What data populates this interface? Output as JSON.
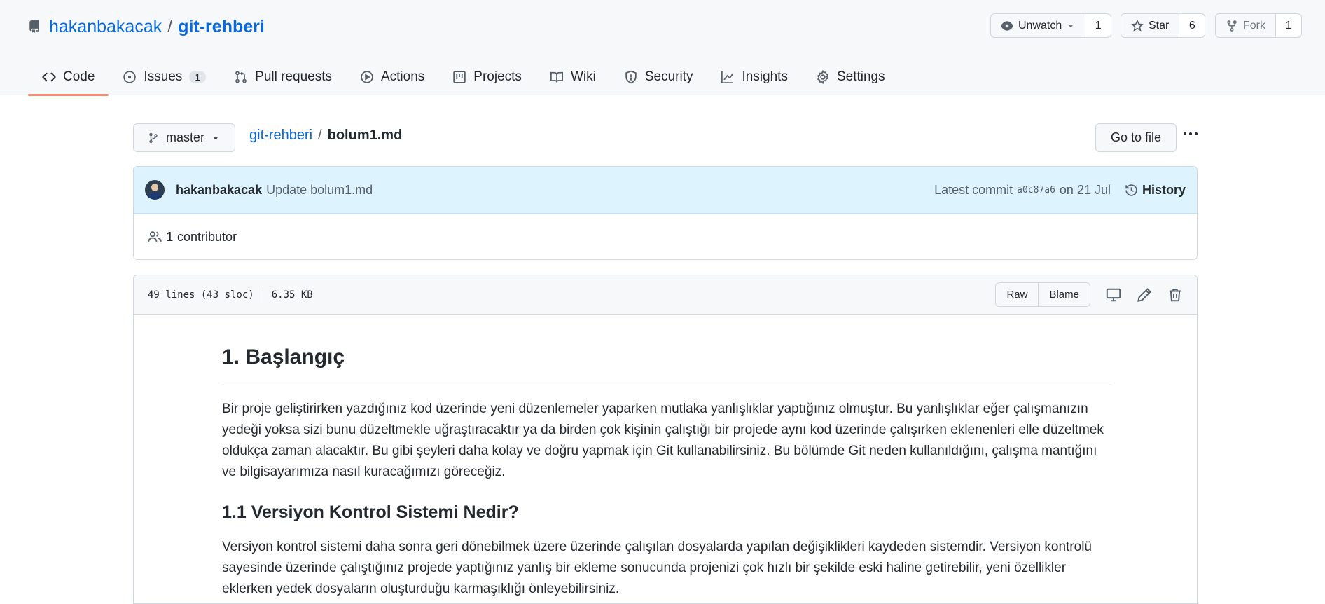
{
  "repo": {
    "owner": "hakanbakacak",
    "separator": "/",
    "name": "git-rehberi"
  },
  "repo_actions": {
    "watch_label": "Unwatch",
    "watch_count": "1",
    "star_label": "Star",
    "star_count": "6",
    "fork_label": "Fork",
    "fork_count": "1"
  },
  "tabs": [
    {
      "label": "Code",
      "icon": "code-icon",
      "active": true
    },
    {
      "label": "Issues",
      "icon": "issue-opened-icon",
      "counter": "1"
    },
    {
      "label": "Pull requests",
      "icon": "git-pull-request-icon"
    },
    {
      "label": "Actions",
      "icon": "play-icon"
    },
    {
      "label": "Projects",
      "icon": "project-icon"
    },
    {
      "label": "Wiki",
      "icon": "book-icon"
    },
    {
      "label": "Security",
      "icon": "shield-icon"
    },
    {
      "label": "Insights",
      "icon": "graph-icon"
    },
    {
      "label": "Settings",
      "icon": "gear-icon"
    }
  ],
  "branch": {
    "name": "master"
  },
  "breadcrumb": {
    "repo": "git-rehberi",
    "separator": "/",
    "file": "bolum1.md"
  },
  "goto_file_label": "Go to file",
  "commit": {
    "author": "hakanbakacak",
    "message": "Update bolum1.md",
    "latest_label": "Latest commit",
    "hash": "a0c87a6",
    "date": "on 21 Jul",
    "history_label": "History"
  },
  "contributors": {
    "count": "1",
    "label": "contributor"
  },
  "file_info": {
    "lines": "49 lines (43 sloc)",
    "size": "6.35 KB",
    "raw_label": "Raw",
    "blame_label": "Blame"
  },
  "content": {
    "h1": "1. Başlangıç",
    "p1": "Bir proje geliştirirken yazdığınız kod üzerinde yeni düzenlemeler yaparken mutlaka yanlışlıklar yaptığınız olmuştur. Bu yanlışlıklar eğer çalışmanızın yedeği yoksa sizi bunu düzeltmekle uğraştıracaktır ya da birden çok kişinin çalıştığı bir projede aynı kod üzerinde çalışırken eklenenleri elle düzeltmek oldukça zaman alacaktır. Bu gibi şeyleri daha kolay ve doğru yapmak için Git kullanabilirsiniz. Bu bölümde Git neden kullanıldığını, çalışma mantığını ve bilgisayarımıza nasıl kuracağımızı göreceğiz.",
    "h2": "1.1 Versiyon Kontrol Sistemi Nedir?",
    "p2": "Versiyon kontrol sistemi daha sonra geri dönebilmek üzere üzerinde çalışılan dosyalarda yapılan değişiklikleri kaydeden sistemdir. Versiyon kontrolü sayesinde üzerinde çalıştığınız projede yaptığınız yanlış bir ekleme sonucunda projenizi çok hızlı bir şekilde eski haline getirebilir, yeni özellikler eklerken yedek dosyaların oluşturduğu karmaşıklığı önleyebilirsiniz."
  }
}
